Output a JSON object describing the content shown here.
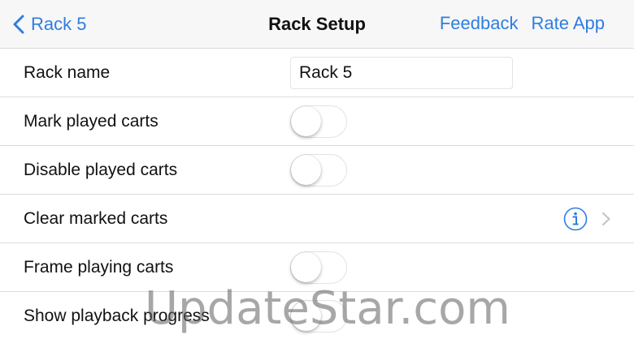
{
  "navbar": {
    "back_label": "Rack 5",
    "title": "Rack Setup",
    "feedback_label": "Feedback",
    "rate_label": "Rate App"
  },
  "rows": {
    "rack_name": {
      "label": "Rack name",
      "value": "Rack 5"
    },
    "mark_played": {
      "label": "Mark played carts",
      "on": false
    },
    "disable_played": {
      "label": "Disable played carts",
      "on": false
    },
    "clear_marked": {
      "label": "Clear marked carts"
    },
    "frame_playing": {
      "label": "Frame playing carts",
      "on": false
    },
    "show_progress": {
      "label": "Show playback progress",
      "on": false
    }
  },
  "watermark": "UpdateStar.com",
  "colors": {
    "accent": "#2f7de1",
    "separator": "#dcdce0",
    "navbar_bg": "#f7f7f8"
  }
}
